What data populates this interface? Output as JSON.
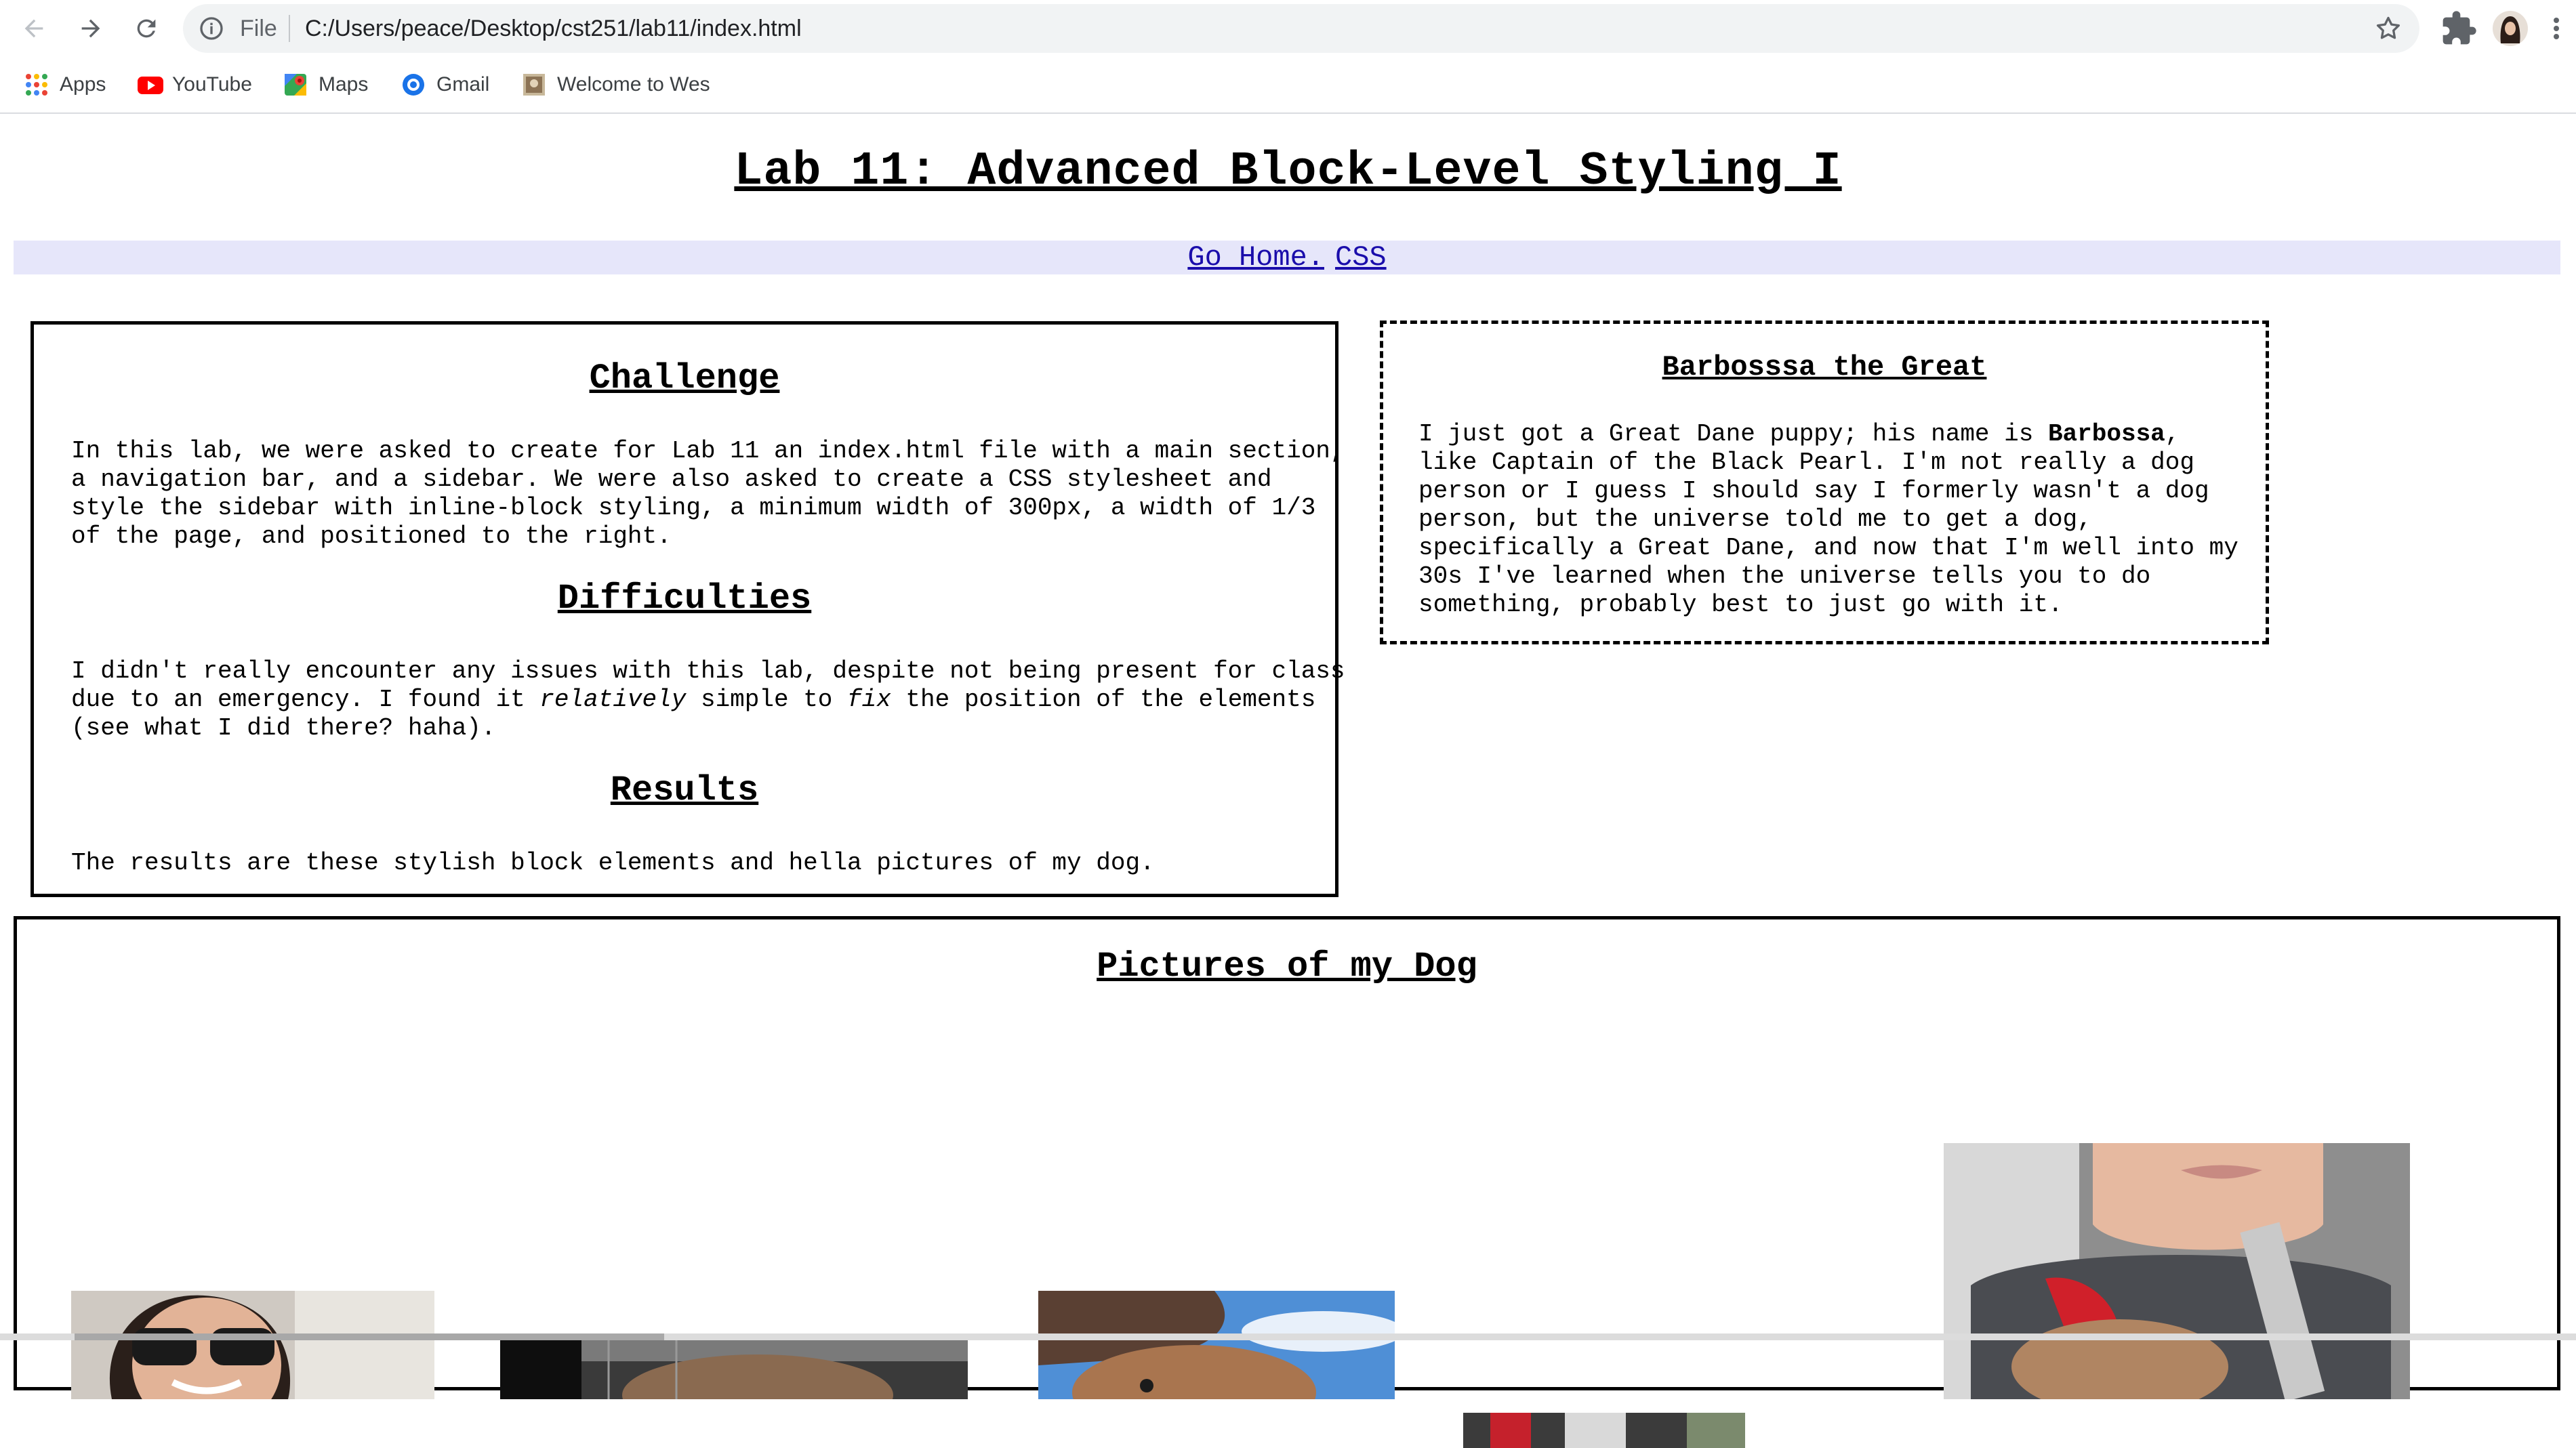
{
  "browser": {
    "nav": {
      "back": "back-arrow",
      "forward": "forward-arrow",
      "reload": "reload"
    },
    "omnibox": {
      "scheme_label": "File",
      "url": "C:/Users/peace/Desktop/cst251/lab11/index.html"
    },
    "bookmarks": [
      {
        "label": "Apps",
        "icon": "apps-grid-icon"
      },
      {
        "label": "YouTube",
        "icon": "youtube-icon"
      },
      {
        "label": "Maps",
        "icon": "maps-icon"
      },
      {
        "label": "Gmail",
        "icon": "gmail-icon"
      },
      {
        "label": "Welcome to Wes",
        "icon": "site-favicon"
      }
    ]
  },
  "page": {
    "title": "Lab 11: Advanced Block-Level Styling I",
    "nav_links": [
      "Go Home.",
      "CSS"
    ],
    "main": {
      "sections": [
        {
          "heading": "Challenge",
          "paragraph": "In this lab, we were asked to create for Lab 11 an index.html file with a main section, a navigation bar, and a sidebar. We were also asked to create a CSS stylesheet and style the sidebar with inline-block styling, a minimum width of 300px, a width of 1/3 of the page, and positioned to the right."
        },
        {
          "heading": "Difficulties",
          "paragraph_parts": [
            "I didn't really encounter any issues with this lab, despite not being present for class due to an emergency. I found it ",
            "relatively",
            " simple to ",
            "fix",
            " the position of the elements (see what I did there? haha)."
          ]
        },
        {
          "heading": "Results",
          "paragraph": "The results are these stylish block elements and hella pictures of my dog."
        }
      ]
    },
    "sidebar": {
      "heading": "Barbosssa the Great",
      "paragraph_parts": [
        "I just got a Great Dane puppy; his name is ",
        "Barbossa",
        ", like Captain of the Black Pearl. I'm not really a dog person or I guess I should say I formerly wasn't a dog person, but the universe told me to get a dog, specifically a Great Dane, and now that I'm well into my 30s I've learned when the universe tells you to do something, probably best to just go with it."
      ]
    },
    "gallery": {
      "heading": "Pictures of my Dog",
      "photos": [
        "photo-selfie-car",
        "photo-dog-crate",
        "photo-dog-sky",
        "photo-dog-blanket",
        "photo-boy-holding-puppy"
      ]
    }
  },
  "colors": {
    "nav_bg": "#e6e6fa",
    "link": "#1a0dab",
    "chrome_bg": "#f1f3f4"
  }
}
